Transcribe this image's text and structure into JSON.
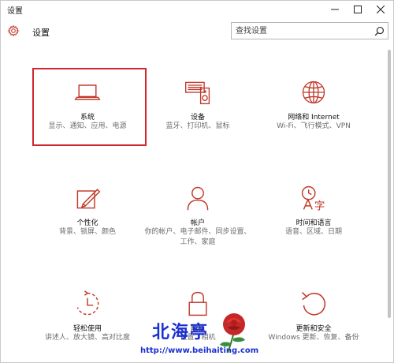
{
  "window": {
    "title": "设置"
  },
  "header": {
    "title": "设置",
    "search_placeholder": "查找设置"
  },
  "tiles": [
    {
      "name": "系统",
      "desc": "显示、通知、应用、电源",
      "icon": "laptop-icon"
    },
    {
      "name": "设备",
      "desc": "蓝牙、打印机、鼠标",
      "icon": "devices-icon"
    },
    {
      "name": "网络和 Internet",
      "desc": "Wi-Fi、飞行模式、VPN",
      "icon": "globe-icon"
    },
    {
      "name": "个性化",
      "desc": "背景、锁屏、颜色",
      "icon": "personalization-icon"
    },
    {
      "name": "帐户",
      "desc": "你的帐户、电子邮件、同步设置、工作、家庭",
      "icon": "person-icon"
    },
    {
      "name": "时间和语言",
      "desc": "语音、区域、日期",
      "icon": "time-language-icon"
    },
    {
      "name": "轻松使用",
      "desc": "讲述人、放大镜、高对比度",
      "icon": "ease-of-access-icon"
    },
    {
      "name": "隐私",
      "desc": "位置、相机",
      "icon": "lock-icon"
    },
    {
      "name": "更新和安全",
      "desc": "Windows 更新、恢复、备份",
      "icon": "update-icon"
    }
  ],
  "colors": {
    "accent": "#c0392b",
    "highlight": "#d0262d",
    "watermark": "#1a2fd0"
  },
  "watermark": {
    "text": "北海亭",
    "url": "http://www.beihaiting.com"
  }
}
